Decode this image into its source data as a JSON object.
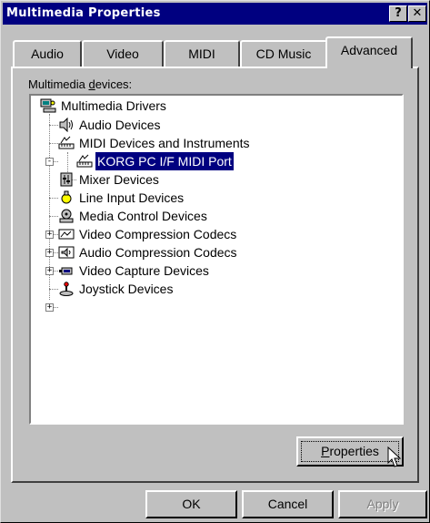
{
  "window": {
    "title": "Multimedia Properties"
  },
  "titlebar_buttons": {
    "help": "?",
    "close": "✕"
  },
  "tabs": [
    {
      "label": "Audio"
    },
    {
      "label": "Video"
    },
    {
      "label": "MIDI"
    },
    {
      "label": "CD Music"
    },
    {
      "label": "Advanced"
    }
  ],
  "active_tab": "Advanced",
  "devices_label": {
    "pre": "Multimedia ",
    "accel": "d",
    "post": "evices:"
  },
  "tree": [
    {
      "label": "Multimedia Drivers",
      "icon": "computer-icon",
      "level": 0,
      "expander": ""
    },
    {
      "label": "Audio Devices",
      "icon": "speaker-icon",
      "level": 1,
      "expander": ""
    },
    {
      "label": "MIDI Devices and Instruments",
      "icon": "midi-icon",
      "level": 1,
      "expander": "-"
    },
    {
      "label": "KORG PC I/F MIDI Port",
      "icon": "midi-icon",
      "level": 2,
      "expander": "",
      "selected": true
    },
    {
      "label": "Mixer Devices",
      "icon": "mixer-icon",
      "level": 1,
      "expander": ""
    },
    {
      "label": "Line Input Devices",
      "icon": "line-input-icon",
      "level": 1,
      "expander": ""
    },
    {
      "label": "Media Control Devices",
      "icon": "media-control-icon",
      "level": 1,
      "expander": "+"
    },
    {
      "label": "Video Compression Codecs",
      "icon": "video-codec-icon",
      "level": 1,
      "expander": "+"
    },
    {
      "label": "Audio Compression Codecs",
      "icon": "audio-codec-icon",
      "level": 1,
      "expander": "+"
    },
    {
      "label": "Video Capture Devices",
      "icon": "video-capture-icon",
      "level": 1,
      "expander": ""
    },
    {
      "label": "Joystick Devices",
      "icon": "joystick-icon",
      "level": 1,
      "expander": "+"
    }
  ],
  "buttons": {
    "properties": {
      "pre": "",
      "accel": "P",
      "post": "roperties"
    },
    "ok": "OK",
    "cancel": "Cancel",
    "apply": "Apply"
  },
  "colors": {
    "face": "#c0c0c0",
    "title": "#000080",
    "selection": "#000080"
  }
}
